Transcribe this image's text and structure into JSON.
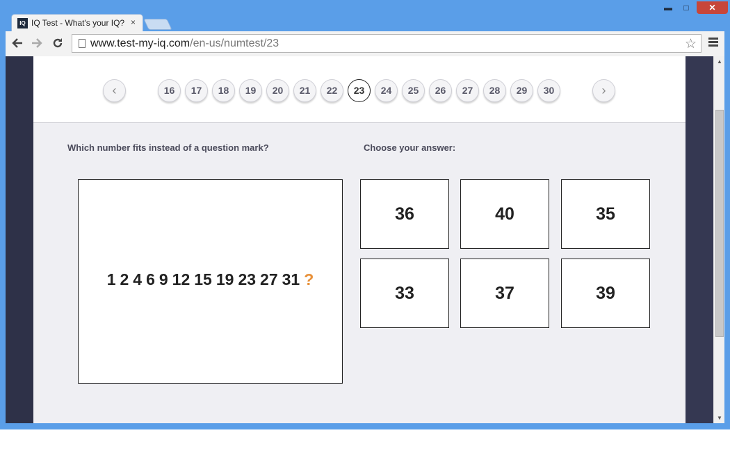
{
  "browser": {
    "tab_title": "IQ Test - What's your IQ?",
    "tab_favicon_text": "IQ",
    "tab_close": "×",
    "url_host": "www.test-my-iq.com",
    "url_path": "/en-us/numtest/23",
    "window_minimize": "▬",
    "window_maximize": "□",
    "window_close": "✕",
    "icons": {
      "back": "back-arrow-icon",
      "forward": "forward-arrow-icon",
      "reload": "reload-icon",
      "bookmark": "star-icon",
      "menu": "hamburger-menu-icon"
    }
  },
  "pager": {
    "prev_symbol": "‹",
    "next_symbol": "›",
    "pages": [
      "16",
      "17",
      "18",
      "19",
      "20",
      "21",
      "22",
      "23",
      "24",
      "25",
      "26",
      "27",
      "28",
      "29",
      "30"
    ],
    "current": "23"
  },
  "question": {
    "prompt": "Which number fits instead of a question mark?",
    "sequence": [
      "1",
      "2",
      "4",
      "6",
      "9",
      "12",
      "15",
      "19",
      "23",
      "27",
      "31"
    ],
    "unknown": "?"
  },
  "answers": {
    "label": "Choose your answer:",
    "options": [
      "36",
      "40",
      "35",
      "33",
      "37",
      "39"
    ]
  },
  "colors": {
    "accent_question_mark": "#e8913a",
    "page_bg": "#efeff3",
    "window_frame": "#5a9ee8"
  }
}
